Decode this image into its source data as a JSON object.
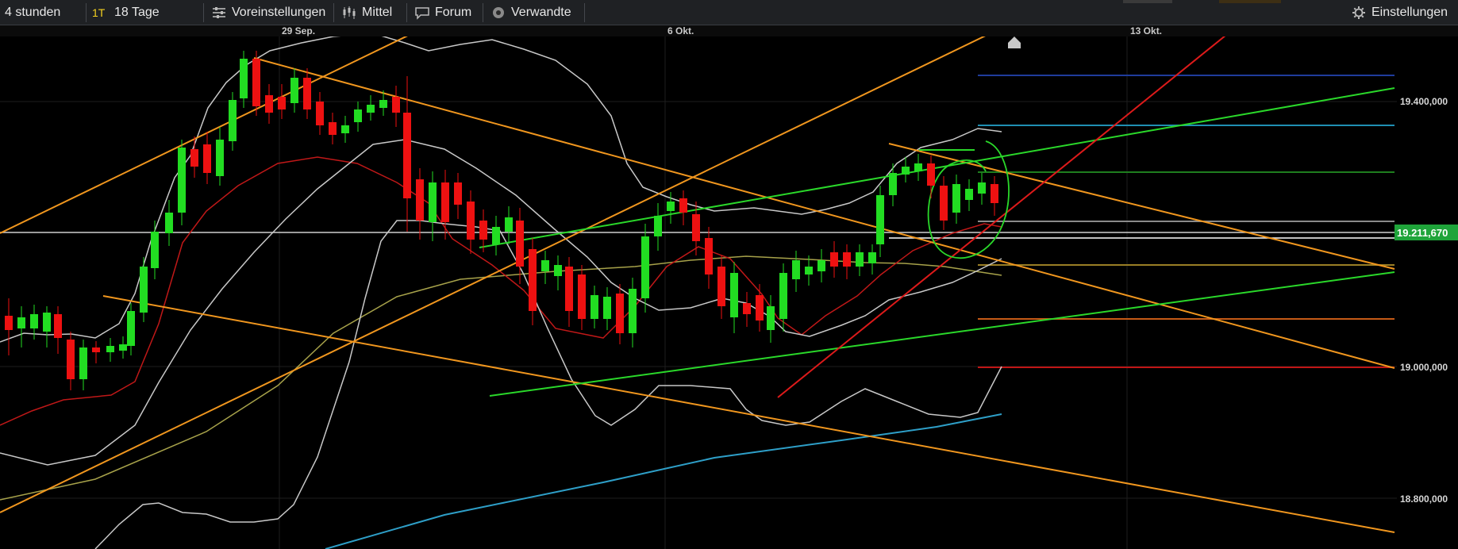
{
  "toolbar": {
    "timeframe": "4 stunden",
    "interval_badge": "1T",
    "range": "18 Tage",
    "presets": "Voreinstellungen",
    "indicator": "Mittel",
    "forum": "Forum",
    "related": "Verwandte",
    "settings": "Einstellungen"
  },
  "x_axis_labels": [
    "29 Sep.",
    "6 Okt.",
    "13 Okt."
  ],
  "y_axis_labels": [
    "19.400,000",
    "19.000,000",
    "18.800,000"
  ],
  "current_price": "19.211,670",
  "colors": {
    "background": "#000000",
    "bull": "#22dd22",
    "bear": "#ee1111",
    "trend_orange": "#f0961e",
    "trend_green": "#2ad82a",
    "trend_red": "#dd1a1a",
    "bollinger": "#c8c8c8",
    "ma_red": "#c01818",
    "ma_olive": "#a7a24a",
    "ma_blue": "#2e9fc8",
    "price_tag": "#1fa43a"
  },
  "icons": [
    "sliders-icon",
    "candlestick-icon",
    "speech-bubble-icon",
    "eye-icon",
    "gear-icon",
    "home-marker-icon"
  ]
}
